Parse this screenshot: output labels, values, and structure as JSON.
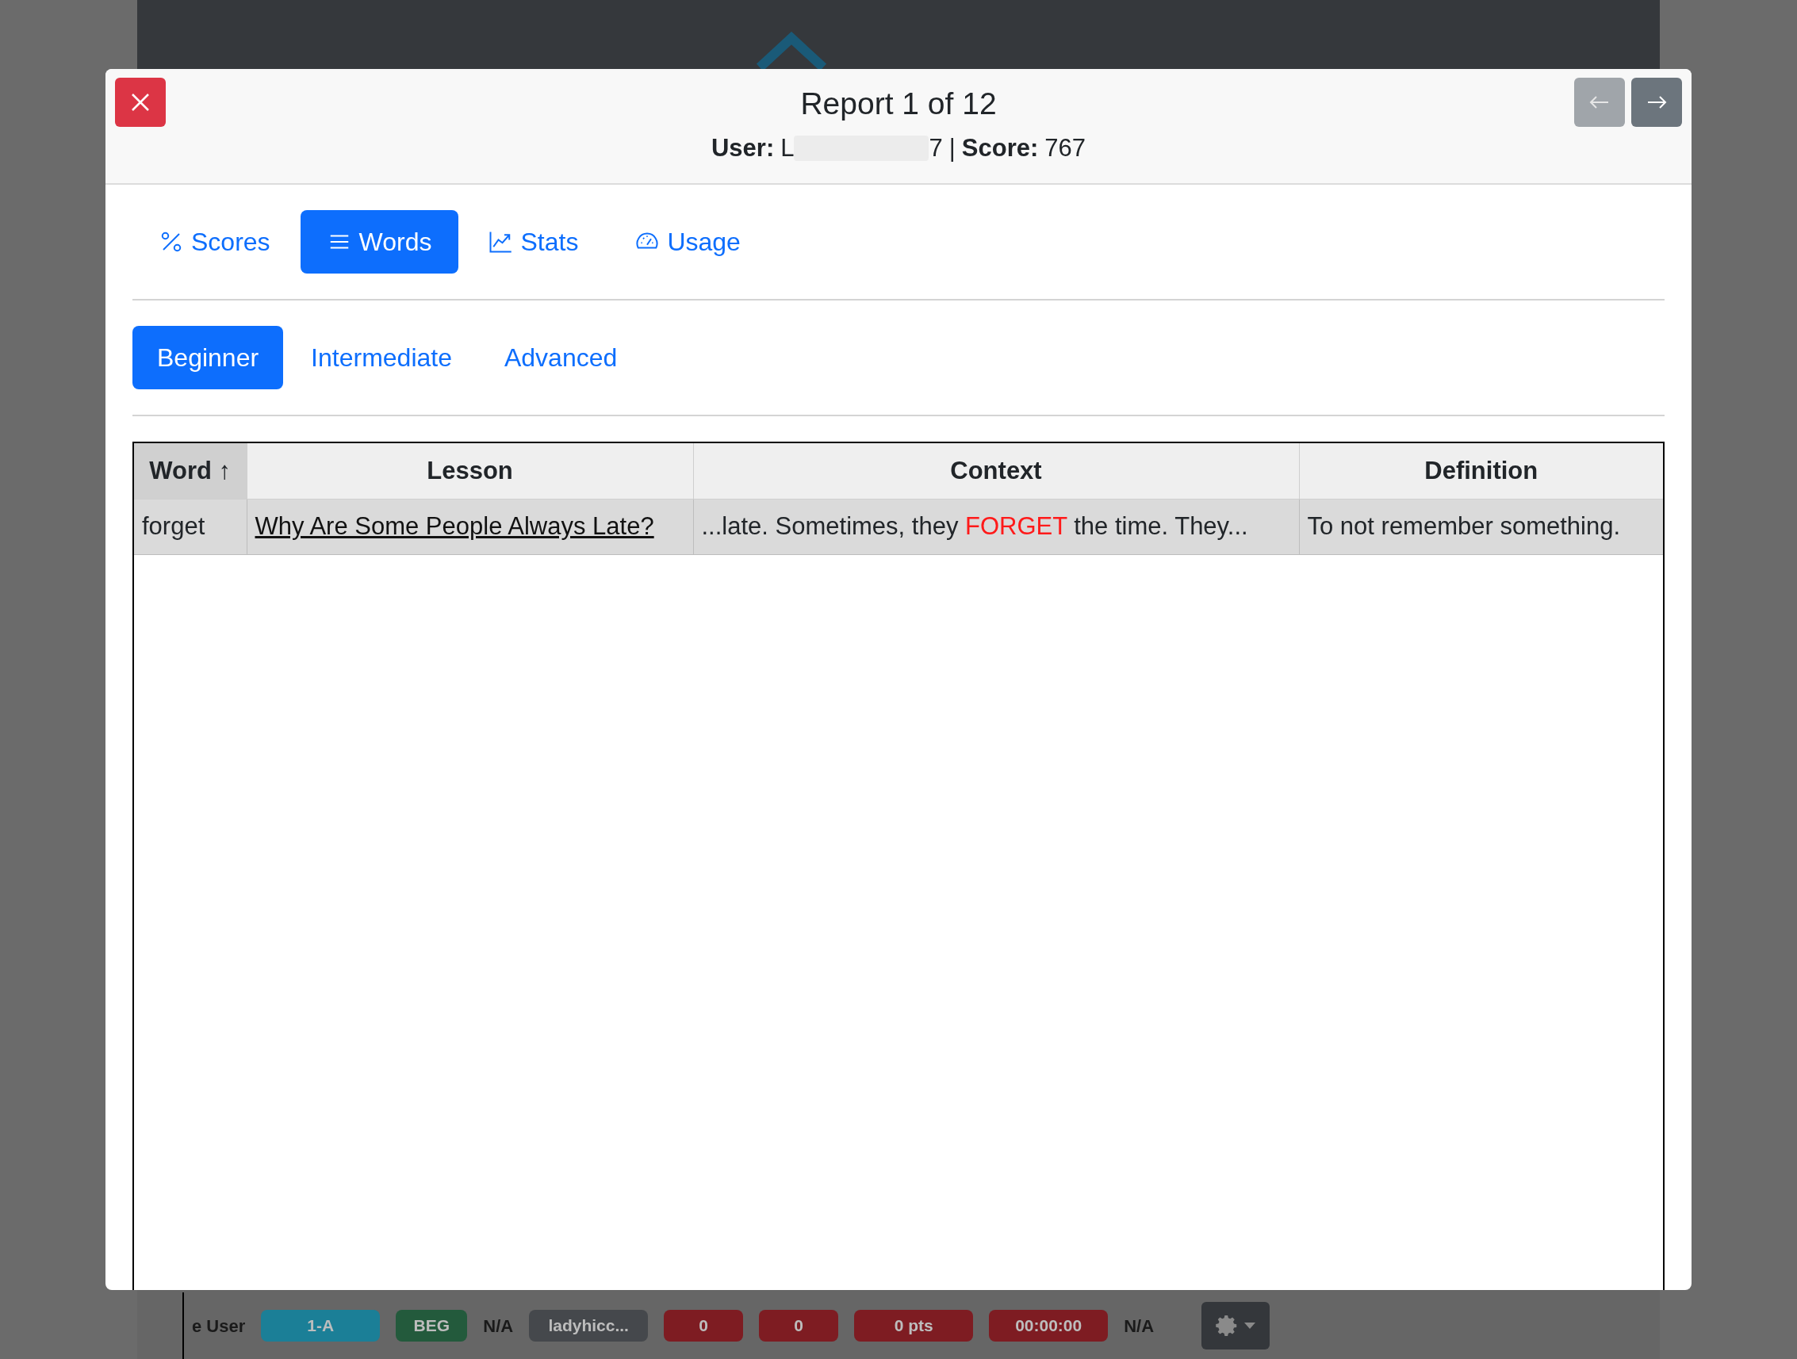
{
  "background": {
    "row": [
      {
        "kind": "text",
        "text": "e User"
      },
      {
        "kind": "badge",
        "text": "1-A",
        "color": "#1b7f97"
      },
      {
        "kind": "badge",
        "text": "BEG",
        "color": "#235a3c"
      },
      {
        "kind": "text",
        "text": "N/A"
      },
      {
        "kind": "badge",
        "text": "ladyhicc...",
        "color": "#45484c"
      },
      {
        "kind": "badge",
        "text": "0",
        "color": "#7e1c22"
      },
      {
        "kind": "badge",
        "text": "0",
        "color": "#7e1c22"
      },
      {
        "kind": "badge",
        "text": "0 pts",
        "color": "#7e1c22"
      },
      {
        "kind": "badge",
        "text": "00:00:00",
        "color": "#7e1c22"
      },
      {
        "kind": "text",
        "text": "N/A"
      },
      {
        "kind": "menu"
      }
    ]
  },
  "modal": {
    "title": "Report 1 of 12",
    "user_label": "User:",
    "user_start": "L",
    "user_end": "7",
    "separator": "|",
    "score_label": "Score:",
    "score": "767",
    "nav": [
      {
        "kind": "prev",
        "disabled": true
      },
      {
        "kind": "next",
        "disabled": false
      }
    ],
    "tabs": [
      {
        "kind": "percent",
        "label": "Scores",
        "selected": false
      },
      {
        "kind": "list",
        "label": "Words",
        "selected": true
      },
      {
        "kind": "chart",
        "label": "Stats",
        "selected": false
      },
      {
        "kind": "gauge",
        "label": "Usage",
        "selected": false
      }
    ],
    "levels": [
      {
        "label": "Beginner",
        "selected": true
      },
      {
        "label": "Intermediate",
        "selected": false
      },
      {
        "label": "Advanced",
        "selected": false
      }
    ],
    "table": {
      "columns": [
        {
          "label": "Word",
          "sort_indicator": "↑",
          "sorted": true
        },
        {
          "label": "Lesson",
          "sorted": false
        },
        {
          "label": "Context",
          "sorted": false
        },
        {
          "label": "Definition",
          "sorted": false
        }
      ],
      "rows": [
        {
          "word": "forget",
          "lesson": "Why Are Some People Always Late?",
          "context_before": "...late. Sometimes, they",
          "context_highlight": "FORGET",
          "context_after": "the time. They...",
          "definition": "To not remember something."
        }
      ]
    }
  }
}
